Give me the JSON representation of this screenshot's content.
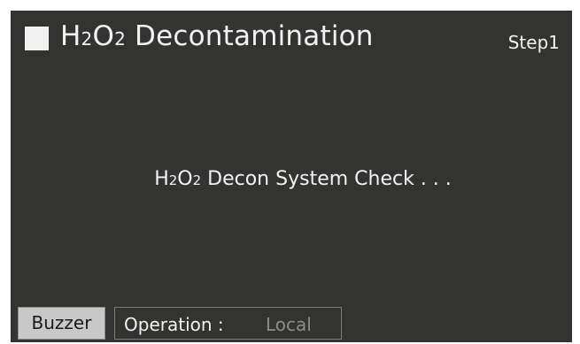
{
  "header": {
    "title_h": "H",
    "title_sub1": "2",
    "title_o": "O",
    "title_sub2": "2",
    "title_rest": " Decontamination",
    "step": "Step1"
  },
  "main": {
    "message_h": "H",
    "message_sub1": "2",
    "message_o": "O",
    "message_sub2": "2",
    "message_rest": " Decon System Check . . ."
  },
  "footer": {
    "buzzer_label": "Buzzer",
    "operation_label": "Operation :",
    "operation_value": "Local"
  },
  "colors": {
    "screen_background": "#333432",
    "text_primary": "#f2f2f2",
    "text_inactive": "#8c8c8c",
    "button_background": "#c8c8c8"
  },
  "icons": {
    "title_marker": "filled-square-icon"
  }
}
